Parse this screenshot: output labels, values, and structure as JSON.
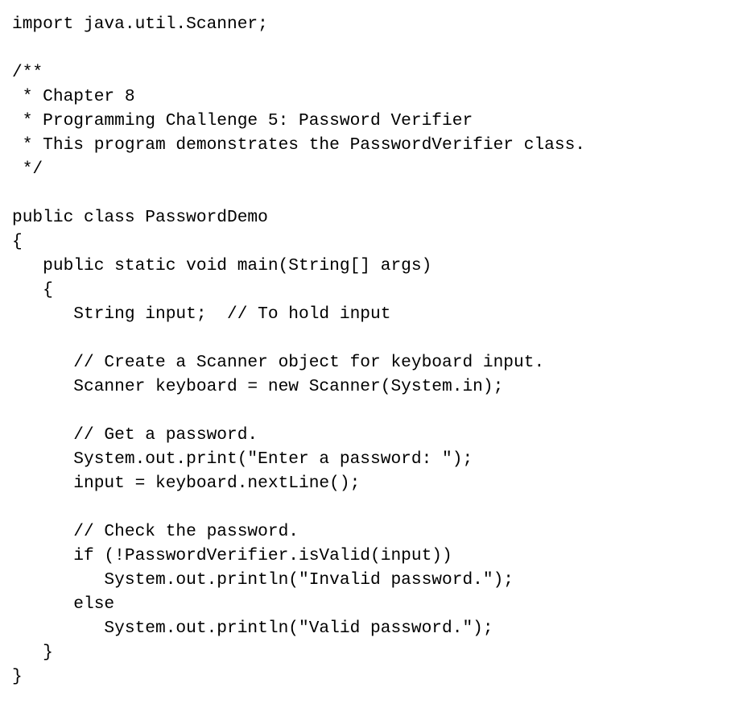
{
  "document": {
    "kind": "source-code-listing",
    "language": "Java",
    "class_name": "PasswordDemo",
    "background_color": "#ffffff",
    "text_color": "#000000"
  },
  "code": {
    "lines": [
      "import java.util.Scanner;",
      "",
      "/**",
      " * Chapter 8",
      " * Programming Challenge 5: Password Verifier",
      " * This program demonstrates the PasswordVerifier class.",
      " */",
      "",
      "public class PasswordDemo",
      "{",
      "   public static void main(String[] args)",
      "   {",
      "      String input;  // To hold input",
      "",
      "      // Create a Scanner object for keyboard input.",
      "      Scanner keyboard = new Scanner(System.in);",
      "",
      "      // Get a password.",
      "      System.out.print(\"Enter a password: \");",
      "      input = keyboard.nextLine();",
      "",
      "      // Check the password.",
      "      if (!PasswordVerifier.isValid(input))",
      "         System.out.println(\"Invalid password.\");",
      "      else",
      "         System.out.println(\"Valid password.\");",
      "   }",
      "}"
    ]
  }
}
